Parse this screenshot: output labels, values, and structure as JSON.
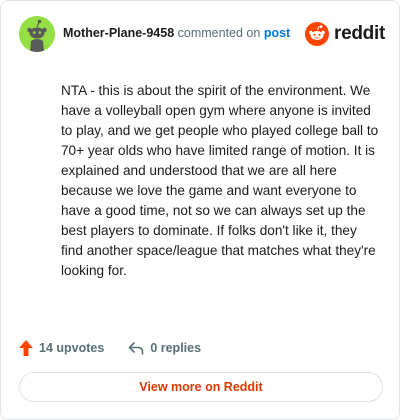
{
  "header": {
    "username": "Mother-Plane-9458",
    "action_text": "commented on",
    "post_link": "post",
    "logo_text": "reddit"
  },
  "comment": {
    "body": "NTA - this is about the spirit of the environment. We have a volleyball open gym where anyone is invited to play, and we get people who played college ball to 70+ year olds who have limited range of motion. It is explained and understood that we are all here because we love the game and want everyone to have a good time, not so we can always set up the best players to dominate. If folks don't like it, they find another space/league that matches what they're looking for."
  },
  "footer": {
    "upvotes": "14 upvotes",
    "replies": "0 replies"
  },
  "cta": {
    "view_more": "View more on Reddit"
  },
  "colors": {
    "brand": "#ff4500",
    "avatar_bg": "#94e044",
    "link": "#0079d3",
    "cta_text": "#d93a00"
  },
  "icons": {
    "avatar": "snoo-avatar-icon",
    "logo": "reddit-logo-icon",
    "upvote": "upvote-arrow-icon",
    "reply": "reply-arrow-icon"
  }
}
